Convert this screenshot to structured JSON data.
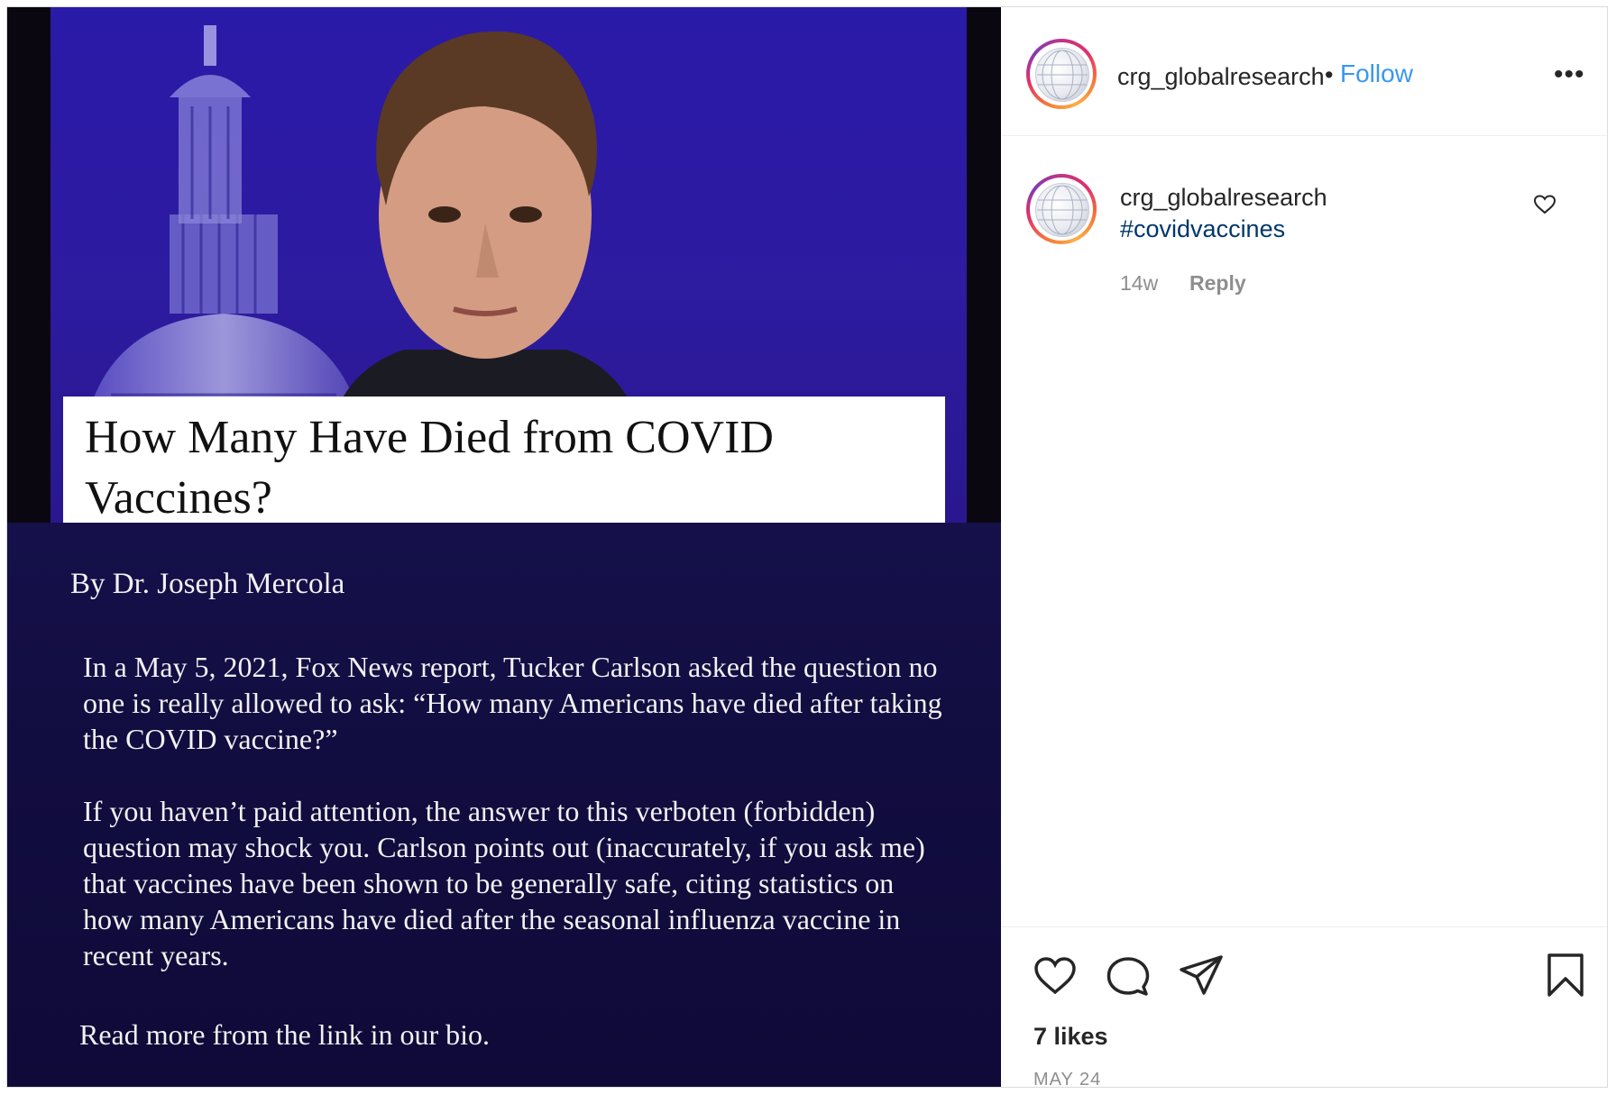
{
  "post": {
    "image": {
      "headline": "How Many Have Died from COVID Vaccines?",
      "byline": "By Dr. Joseph Mercola",
      "paragraph_1": "In a May 5, 2021, Fox News report, Tucker Carlson asked the question no one is really allowed to ask: “How many Americans have died after taking the COVID vaccine?”",
      "paragraph_2": "If you haven’t paid attention, the answer to this verboten (forbidden) question may shock you. Carlson points out (inaccurately, if you ask me) that vaccines have been shown to be generally safe, citing statistics on how many Americans have died after the seasonal influenza vaccine in recent years.",
      "paragraph_3": "Read more from the link in our bio."
    },
    "header": {
      "username": "crg_globalresearch",
      "separator": "•",
      "follow_label": "Follow",
      "more_icon": "more-horizontal-icon",
      "more_label": "•••"
    },
    "caption": {
      "username": "crg_globalresearch",
      "text": "#covidvaccines",
      "time": "14w",
      "reply_label": "Reply",
      "like_icon": "heart-outline-icon"
    },
    "actions": {
      "like_icon": "heart-icon",
      "comment_icon": "comment-icon",
      "share_icon": "share-icon",
      "save_icon": "bookmark-icon",
      "likes": "7 likes",
      "date": "MAY 24"
    },
    "colors": {
      "link_blue": "#3897f0",
      "hashtag": "#00376b",
      "muted": "#8e8e8e",
      "text": "#262626"
    }
  }
}
